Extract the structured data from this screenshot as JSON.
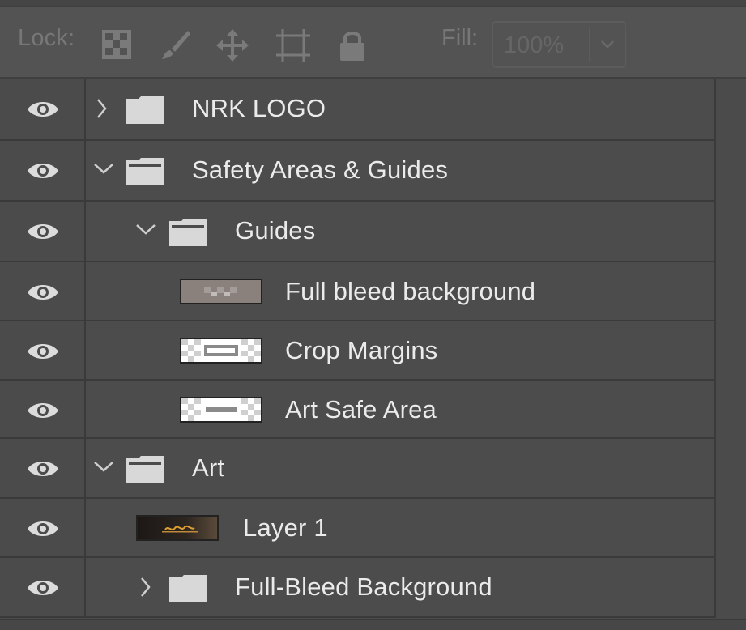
{
  "toolbar": {
    "lock_label": "Lock:",
    "fill_label": "Fill:",
    "fill_value": "100%",
    "icons": [
      "transparent-pixels-lock-icon",
      "brush-icon",
      "move-icon",
      "artboard-icon",
      "padlock-icon",
      "chevron-down-icon"
    ]
  },
  "layers": [
    {
      "name": "NRK LOGO",
      "kind": "group",
      "expanded": false,
      "depth": 0,
      "visible": true
    },
    {
      "name": "Safety Areas & Guides",
      "kind": "group",
      "expanded": true,
      "depth": 0,
      "visible": true
    },
    {
      "name": "Guides",
      "kind": "group",
      "expanded": true,
      "depth": 1,
      "visible": true
    },
    {
      "name": "Full bleed background",
      "kind": "layer",
      "depth": 2,
      "visible": true
    },
    {
      "name": "Crop Margins",
      "kind": "layer",
      "depth": 2,
      "visible": true
    },
    {
      "name": "Art Safe Area",
      "kind": "layer",
      "depth": 2,
      "visible": true
    },
    {
      "name": "Art",
      "kind": "group",
      "expanded": true,
      "depth": 0,
      "visible": true
    },
    {
      "name": "Layer 1",
      "kind": "layer",
      "depth": 1,
      "visible": true
    },
    {
      "name": "Full-Bleed Background",
      "kind": "group",
      "expanded": false,
      "depth": 1,
      "visible": true
    }
  ],
  "colors": {
    "panel_bg": "#4b4b4b",
    "toolbar_bg": "#535353",
    "text": "#ebebeb",
    "disabled_text": "#777777"
  }
}
